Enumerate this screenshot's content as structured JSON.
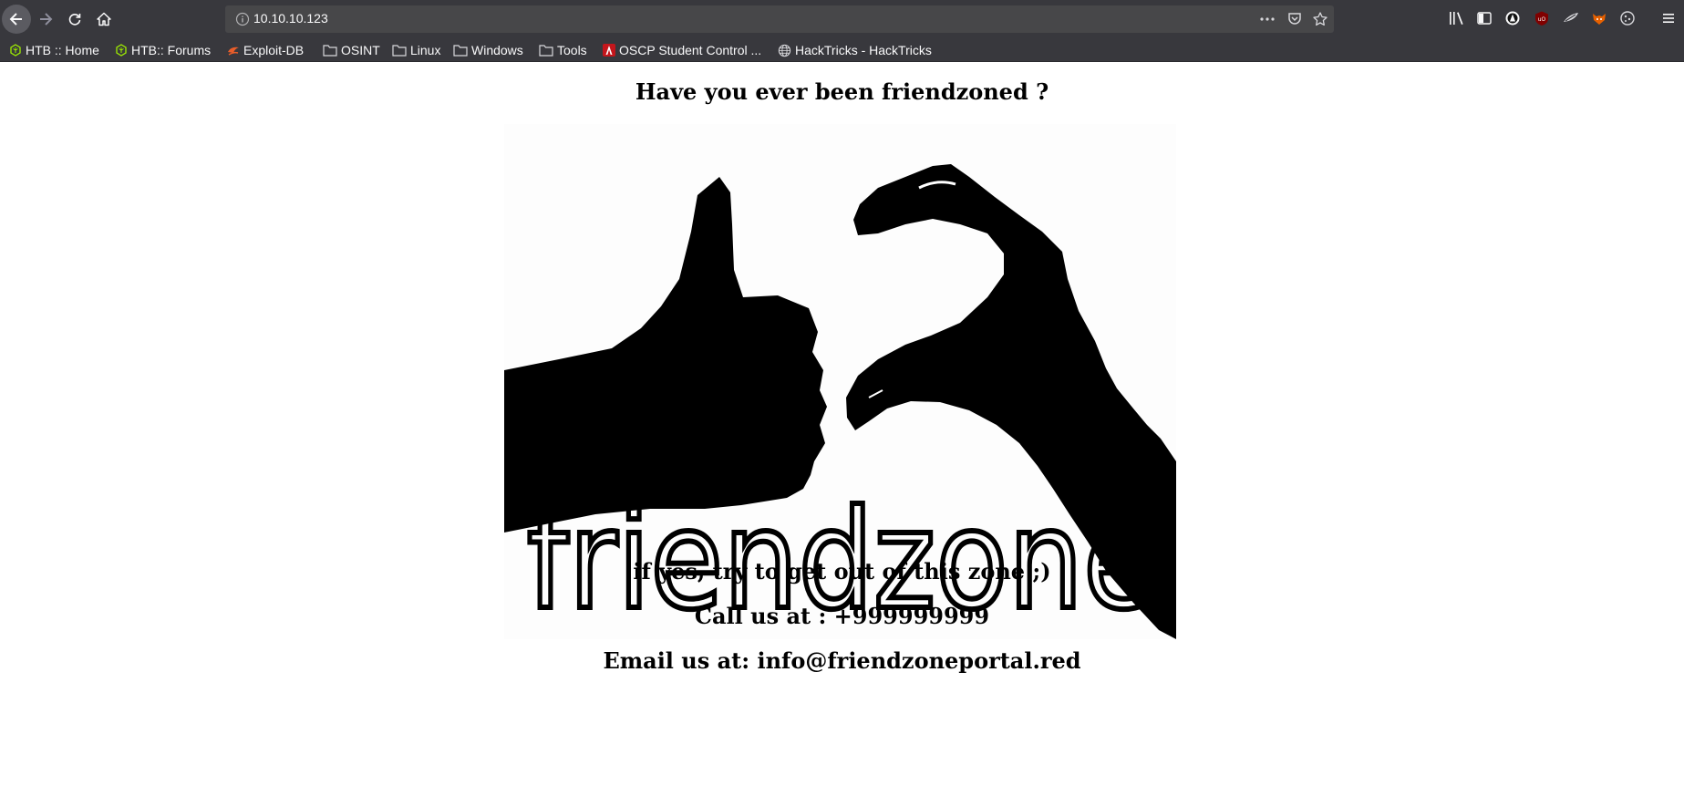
{
  "browser": {
    "url": "10.10.10.123",
    "bookmarks": [
      {
        "label": "HTB :: Home",
        "icon": "htb-icon"
      },
      {
        "label": "HTB:: Forums",
        "icon": "htb-icon"
      },
      {
        "label": "Exploit-DB",
        "icon": "exploitdb-icon"
      },
      {
        "label": "OSINT",
        "icon": "folder-icon"
      },
      {
        "label": "Linux",
        "icon": "folder-icon"
      },
      {
        "label": "Windows",
        "icon": "folder-icon"
      },
      {
        "label": "Tools",
        "icon": "folder-icon"
      },
      {
        "label": "OSCP Student Control ...",
        "icon": "offsec-icon"
      },
      {
        "label": "HackTricks - HackTricks",
        "icon": "globe-icon"
      }
    ]
  },
  "page": {
    "title": "Have you ever been friendzoned ?",
    "image_text": "friendzone",
    "tagline": "if yes, try to get out of this zone ;)",
    "phone": "Call us at : +999999999",
    "email": "Email us at: info@friendzoneportal.red"
  },
  "colors": {
    "chrome": "#38383d",
    "urlbar": "#474749",
    "text_light": "#f9f9fa"
  }
}
